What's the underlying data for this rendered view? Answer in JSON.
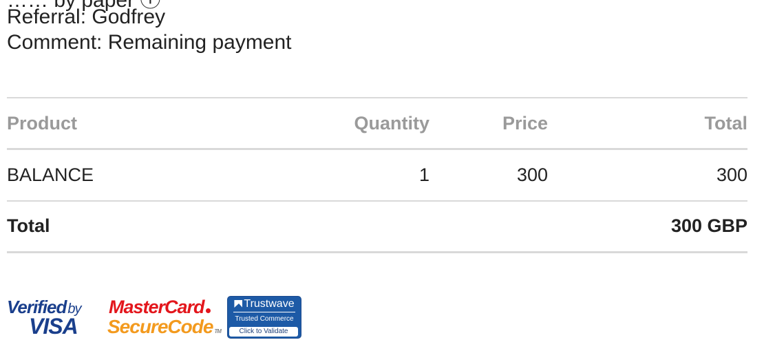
{
  "order_info": {
    "cut_line": "…… by paper ⓘ",
    "referral": "Referral: Godfrey",
    "comment": "Comment: Remaining payment"
  },
  "table": {
    "headers": {
      "product": "Product",
      "quantity": "Quantity",
      "price": "Price",
      "total": "Total"
    },
    "rows": [
      {
        "product": "BALANCE",
        "quantity": "1",
        "price": "300",
        "total": "300"
      }
    ],
    "footer": {
      "label": "Total",
      "amount": "300 GBP"
    }
  },
  "badges": {
    "visa": {
      "line1": "Verified",
      "by": "by",
      "line2": "VISA"
    },
    "mastercard": {
      "line1": "MasterCard",
      "line2": "SecureCode",
      "tm": "TM"
    },
    "trustwave": {
      "title": "Trustwave",
      "subtitle": "Trusted Commerce",
      "button": "Click to Validate"
    }
  },
  "colors": {
    "text": "#222222",
    "header_text": "#9a9a9a",
    "rule": "#d9d9d9",
    "visa_blue": "#1a3f8c",
    "mastercard_red": "#e3161c",
    "mastercard_orange": "#f39a1e",
    "trustwave_blue": "#1d5aa6"
  }
}
